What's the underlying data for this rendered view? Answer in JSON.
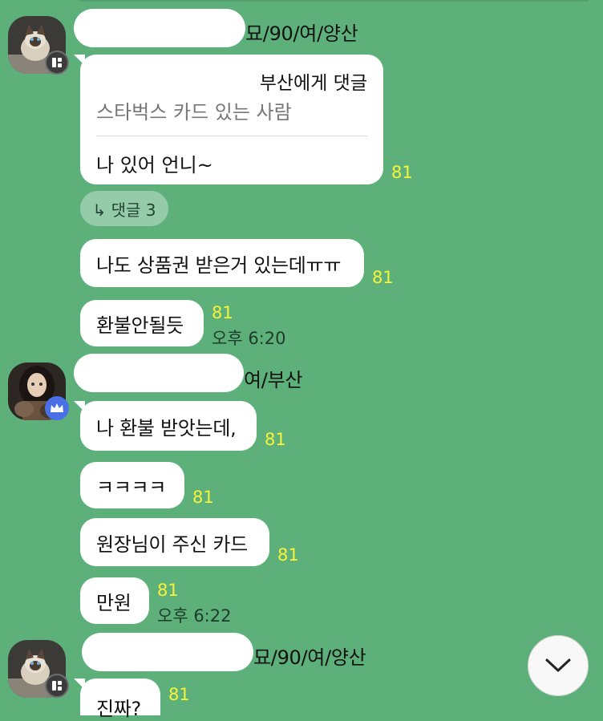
{
  "colors": {
    "background": "#5db07a",
    "bubble": "#ffffff",
    "read_count": "#f7f23a",
    "crown_badge": "#4b6fe6"
  },
  "messages": {
    "m1": {
      "sender_suffix": "묘/90/여/양산",
      "reply_to": "부산에게 댓글",
      "quoted": "스타벅스 카드 있는 사람",
      "text": "나 있어 언니~",
      "count": "81",
      "comments": "↳ 댓글 3"
    },
    "m2": {
      "text": "나도 상품권 받은거 있는데ㅠㅠ",
      "count": "81"
    },
    "m3": {
      "text": "환불안될듯",
      "count": "81",
      "time": "오후 6:20"
    },
    "m4": {
      "sender_suffix": "여/부산",
      "text": "나 환불 받앗는데,",
      "count": "81"
    },
    "m5": {
      "text": "ㅋㅋㅋㅋ",
      "count": "81"
    },
    "m6": {
      "text": "원장님이 주신 카드",
      "count": "81"
    },
    "m7": {
      "text": "만원",
      "count": "81",
      "time": "오후 6:22"
    },
    "m8": {
      "sender_suffix": "묘/90/여/양산",
      "text": "진짜?",
      "count": "81"
    }
  },
  "icons": {
    "profile_badge": "square-grid-icon",
    "admin_badge": "crown-icon",
    "scroll_down": "chevron-down-icon"
  }
}
